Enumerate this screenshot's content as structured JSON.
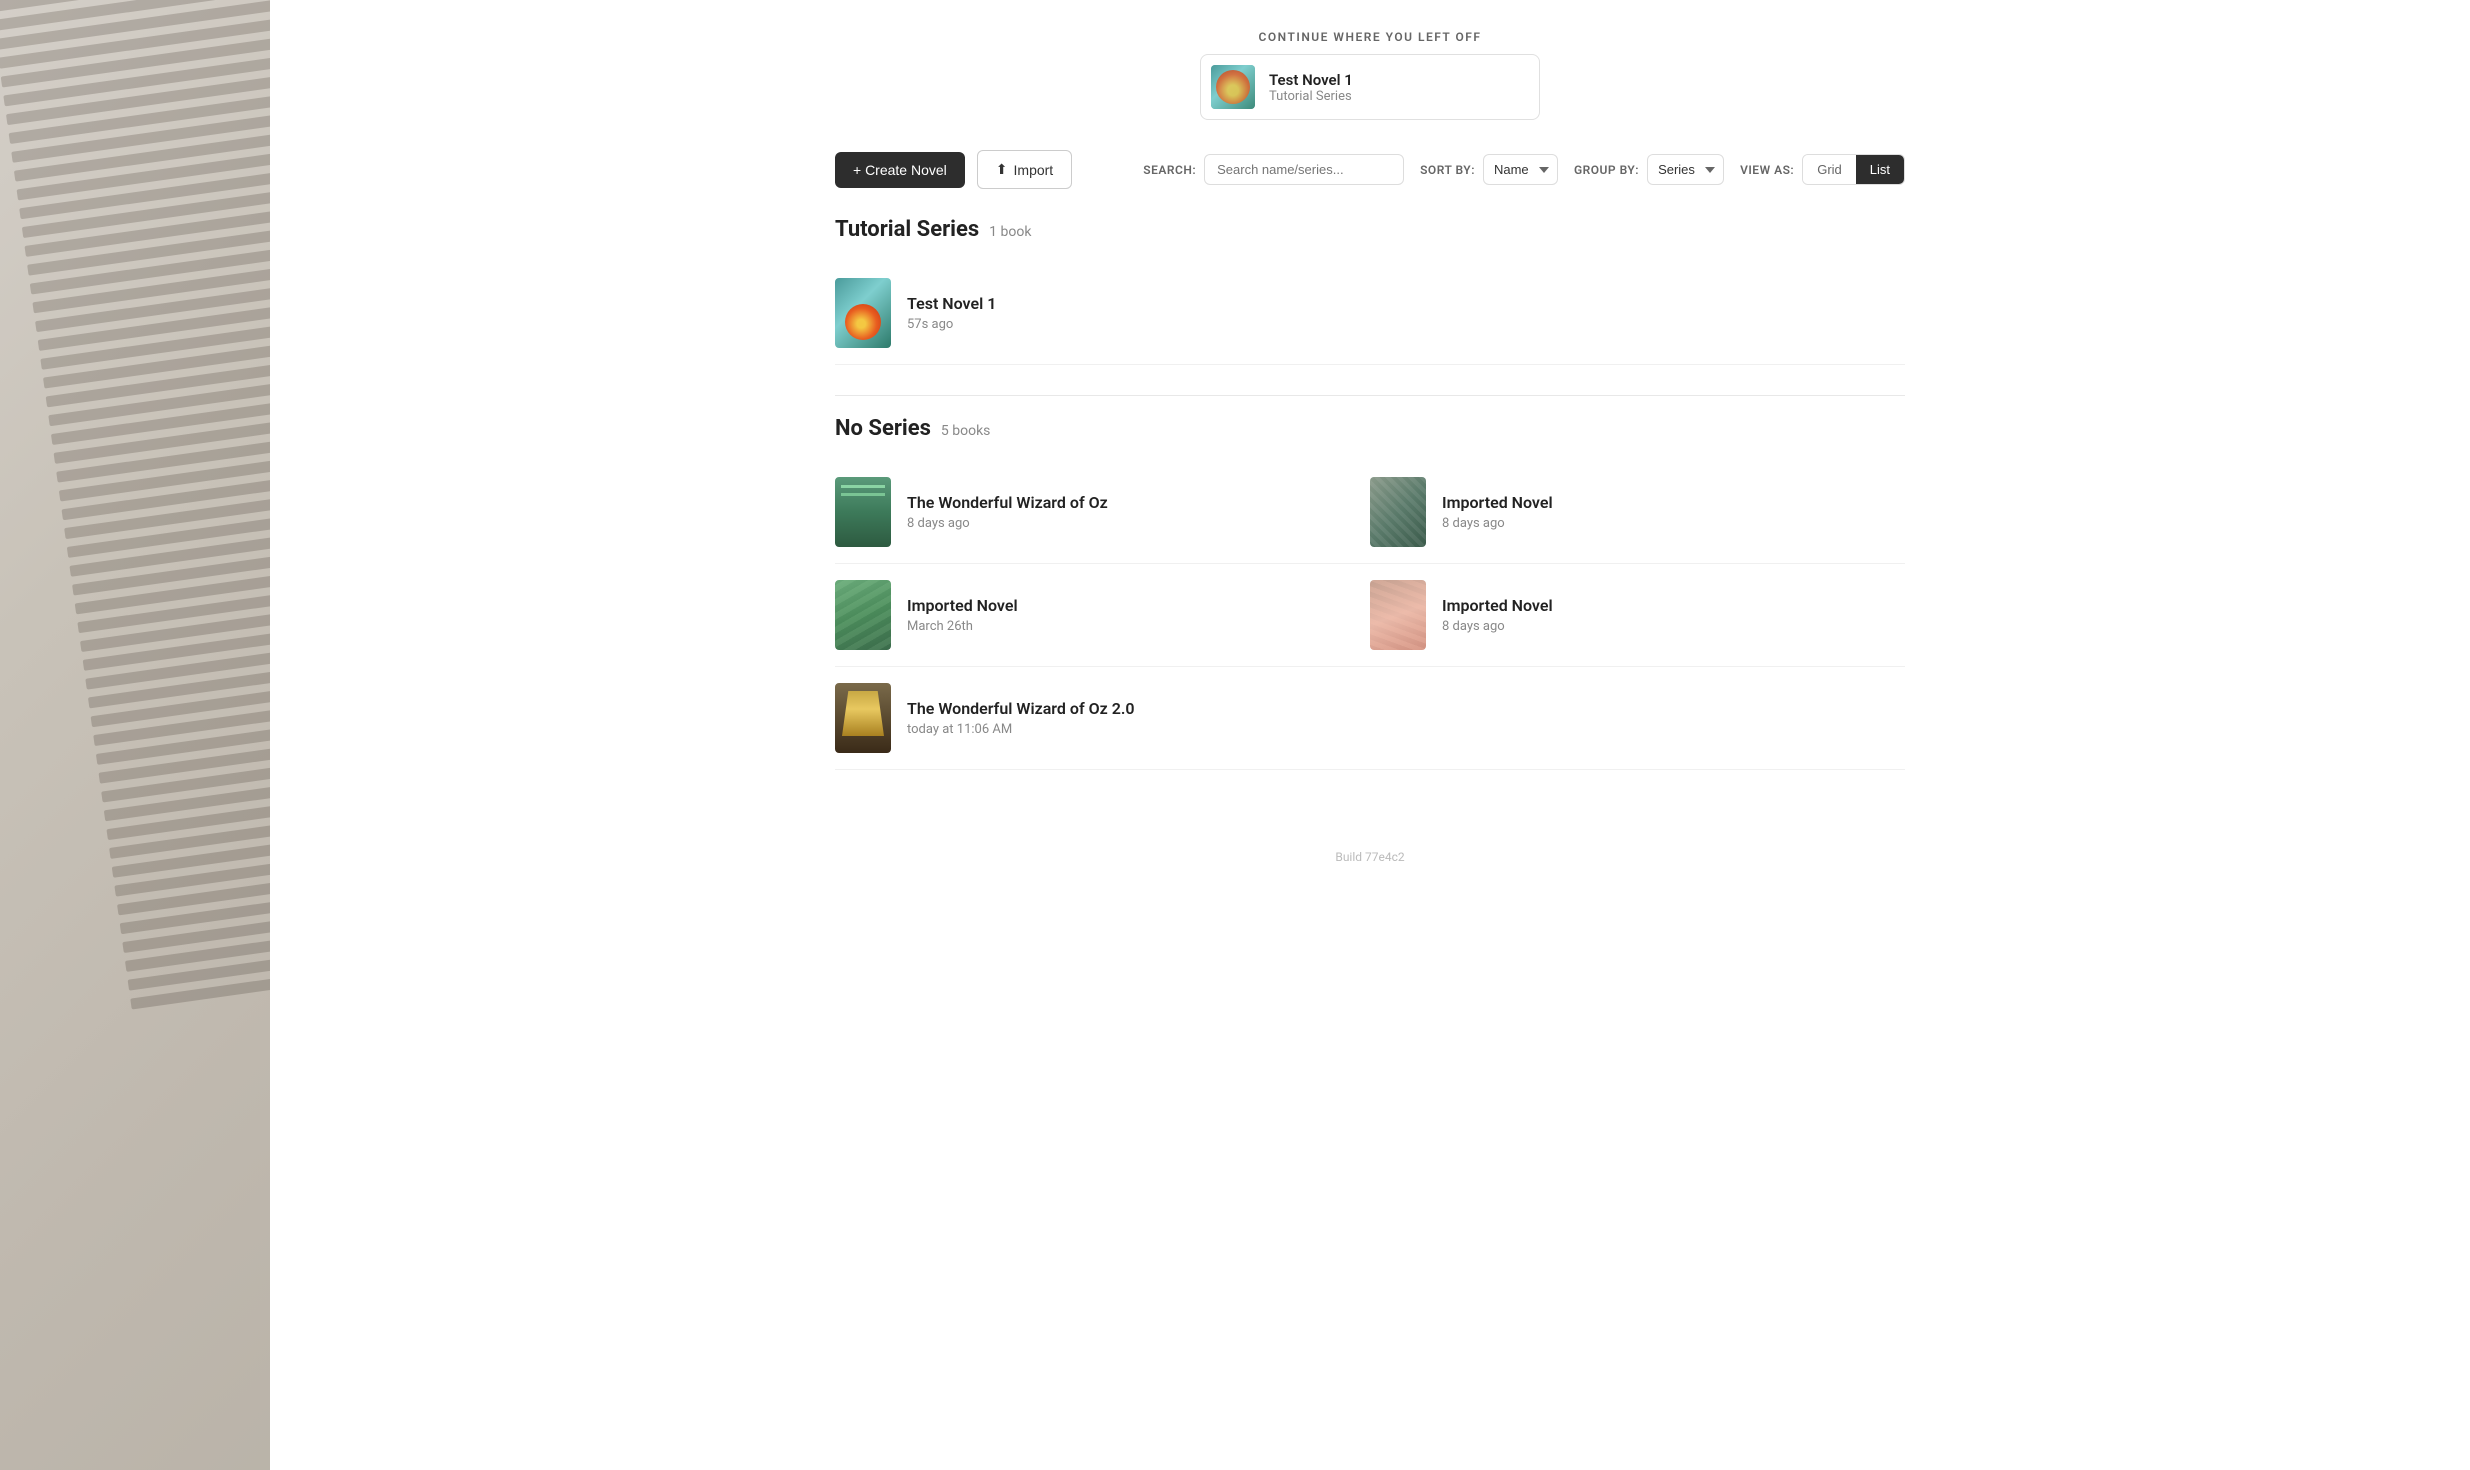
{
  "app": {
    "build": "Build 77e4c2"
  },
  "continue": {
    "label": "CONTINUE WHERE YOU LEFT OFF",
    "novel_title": "Test Novel 1",
    "novel_series": "Tutorial Series"
  },
  "toolbar": {
    "create_label": "+ Create Novel",
    "import_label": "Import",
    "search_label": "SEARCH:",
    "search_placeholder": "Search name/series...",
    "sort_label": "SORT BY:",
    "sort_value": "Name",
    "group_label": "GROUP BY:",
    "group_value": "Series",
    "view_label": "VIEW AS:",
    "view_grid": "Grid",
    "view_list": "List"
  },
  "sections": [
    {
      "title": "Tutorial Series",
      "count": "1 book",
      "novels": [
        {
          "id": "test-novel-1",
          "name": "Test Novel 1",
          "date": "57s ago",
          "thumb_class": "thumb-test-novel-1"
        }
      ]
    },
    {
      "title": "No Series",
      "count": "5 books",
      "novels": [
        {
          "id": "wizard-oz",
          "name": "The Wonderful Wizard of Oz",
          "date": "8 days ago",
          "thumb_class": "thumb-wizard-oz"
        },
        {
          "id": "imported-1",
          "name": "Imported Novel",
          "date": "8 days ago",
          "thumb_class": "thumb-imported-1"
        },
        {
          "id": "imported-2",
          "name": "Imported Novel",
          "date": "March 26th",
          "thumb_class": "thumb-imported-2"
        },
        {
          "id": "imported-3",
          "name": "Imported Novel",
          "date": "8 days ago",
          "thumb_class": "thumb-imported-3"
        },
        {
          "id": "wizard-oz-2",
          "name": "The Wonderful Wizard of Oz 2.0",
          "date": "today at 11:06 AM",
          "thumb_class": "thumb-wizard-oz-2",
          "single": true
        }
      ]
    }
  ]
}
